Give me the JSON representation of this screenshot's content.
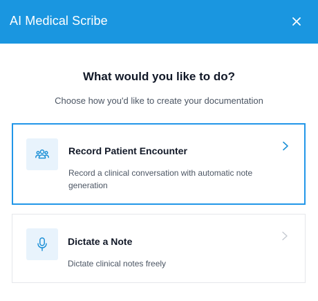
{
  "header": {
    "title": "AI Medical Scribe",
    "close_icon": "close-icon"
  },
  "prompt": {
    "heading": "What would you like to do?",
    "subheading": "Choose how you'd like to create your documentation"
  },
  "options": [
    {
      "title": "Record Patient Encounter",
      "description": "Record a clinical conversation with automatic note generation",
      "icon": "people-icon",
      "selected": true
    },
    {
      "title": "Dictate a Note",
      "description": "Dictate clinical notes freely",
      "icon": "microphone-icon",
      "selected": false
    }
  ],
  "colors": {
    "header_bg": "#1a96e0",
    "accent": "#2196e8",
    "icon_bg": "#e8f3fc"
  }
}
